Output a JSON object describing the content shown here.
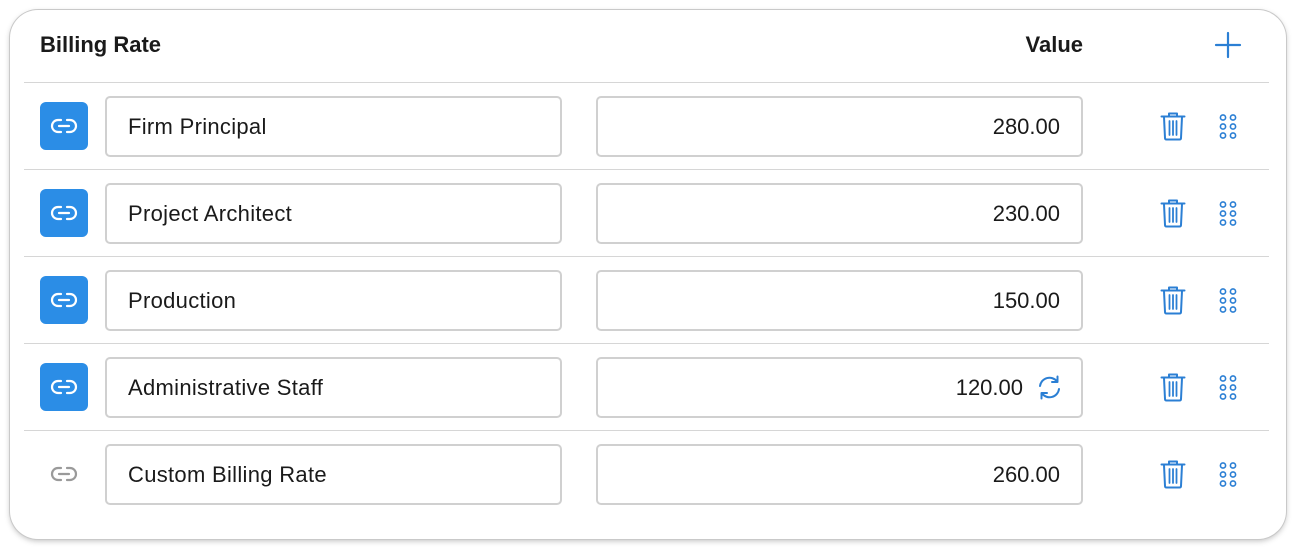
{
  "header": {
    "name_label": "Billing Rate",
    "value_label": "Value"
  },
  "colors": {
    "accent": "#2b8de6",
    "icon_blue": "#2b7fd4",
    "icon_gray": "#9a9a9a",
    "border": "#d0d0d0"
  },
  "rows": [
    {
      "name": "Firm Principal",
      "value": "280.00",
      "linked": true,
      "sync": false
    },
    {
      "name": "Project Architect",
      "value": "230.00",
      "linked": true,
      "sync": false
    },
    {
      "name": "Production",
      "value": "150.00",
      "linked": true,
      "sync": false
    },
    {
      "name": "Administrative Staff",
      "value": "120.00",
      "linked": true,
      "sync": true
    },
    {
      "name": "Custom Billing Rate",
      "value": "260.00",
      "linked": false,
      "sync": false
    }
  ],
  "icons": {
    "add": "plus-icon",
    "link": "link-icon",
    "sync": "sync-icon",
    "delete": "trash-icon",
    "drag": "drag-handle-icon"
  }
}
